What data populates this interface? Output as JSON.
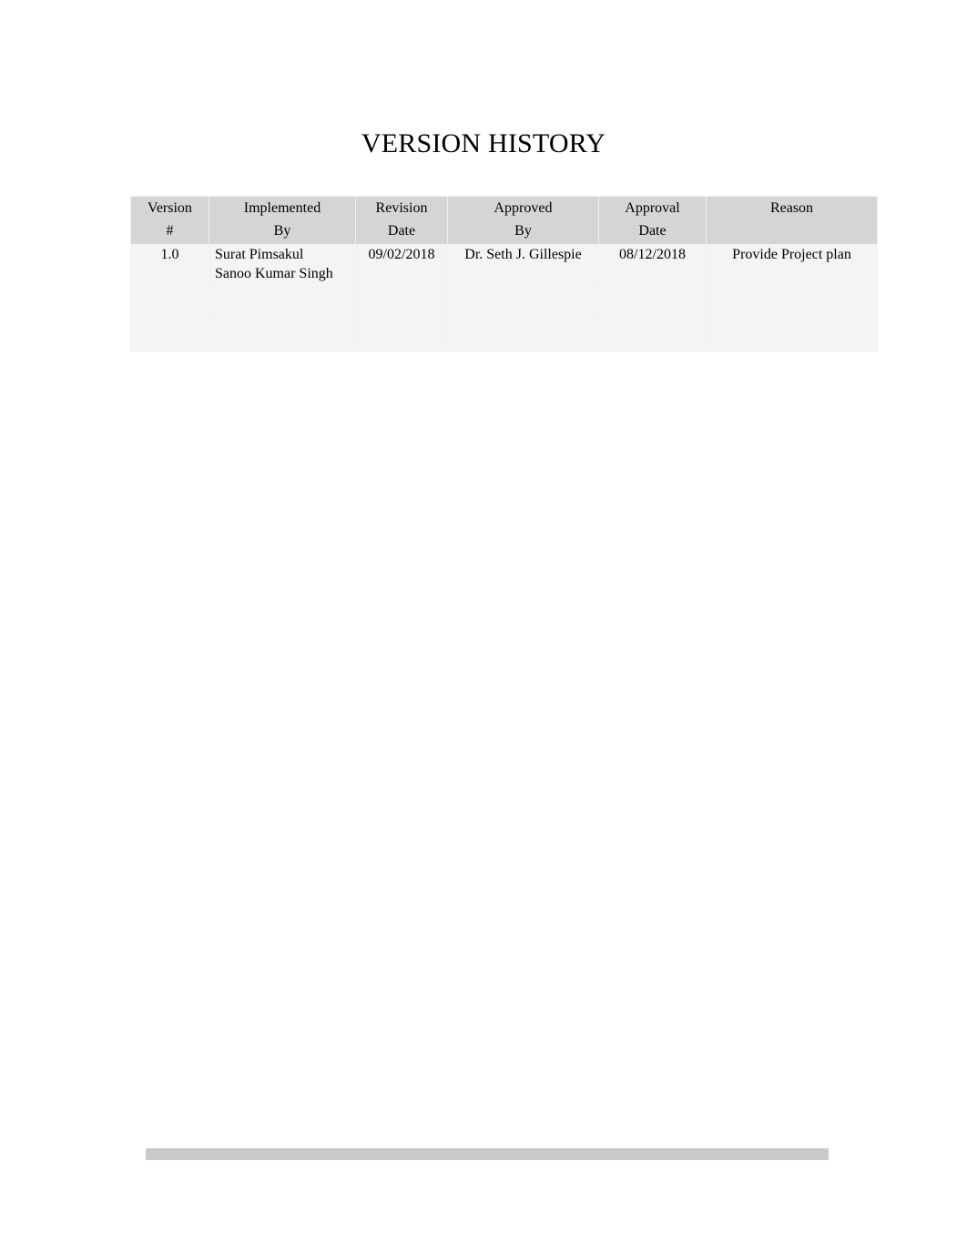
{
  "document": {
    "title": "VERSION HISTORY"
  },
  "table": {
    "headers": [
      {
        "line1": "Version",
        "line2": "#"
      },
      {
        "line1": "Implemented",
        "line2": "By"
      },
      {
        "line1": "Revision",
        "line2": "Date"
      },
      {
        "line1": "Approved",
        "line2": "By"
      },
      {
        "line1": "Approval",
        "line2": "Date"
      },
      {
        "line1": "Reason",
        "line2": ""
      }
    ],
    "rows": [
      {
        "version": "1.0",
        "implemented_by_line1": "Surat Pimsakul",
        "implemented_by_line2": "Sanoo Kumar Singh",
        "revision_date": "09/02/2018",
        "approved_by": "Dr. Seth J. Gillespie",
        "approval_date": "08/12/2018",
        "reason": "Provide Project plan"
      },
      {
        "version": "",
        "implemented_by_line1": "",
        "implemented_by_line2": "",
        "revision_date": "",
        "approved_by": "",
        "approval_date": "",
        "reason": ""
      },
      {
        "version": "",
        "implemented_by_line1": "",
        "implemented_by_line2": "",
        "revision_date": "",
        "approved_by": "",
        "approval_date": "",
        "reason": ""
      }
    ]
  },
  "footer": {
    "bar": ""
  },
  "colors": {
    "header_fill": "#d5d5d5",
    "body_fill": "#f4f4f4",
    "footer_bar": "#c9c9c9",
    "text": "#000000"
  }
}
